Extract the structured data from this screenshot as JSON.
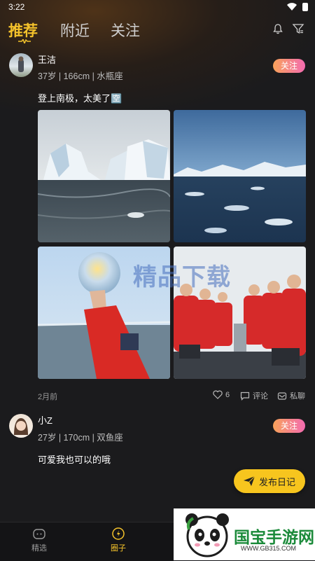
{
  "status": {
    "time": "3:22"
  },
  "tabs": [
    {
      "label": "推荐",
      "active": true
    },
    {
      "label": "附近",
      "active": false
    },
    {
      "label": "关注",
      "active": false
    }
  ],
  "top_icons": [
    "bell-icon",
    "filter-icon"
  ],
  "posts": [
    {
      "username": "王洁",
      "meta": "37岁 | 166cm | 水瓶座",
      "follow_label": "关注",
      "content": "登上南极，太美了🈳",
      "date": "2月前",
      "likes": "6",
      "comment_label": "评论",
      "message_label": "私聊"
    },
    {
      "username": "小Z",
      "meta": "27岁 | 170cm | 双鱼座",
      "follow_label": "关注",
      "content": "可爱我也可以的哦"
    }
  ],
  "publish_label": "发布日记",
  "watermark": {
    "text": "精品下载"
  },
  "bottom_nav": [
    {
      "label": "精选",
      "active": false
    },
    {
      "label": "圈子",
      "active": true
    }
  ],
  "badge": {
    "title": "国宝手游网",
    "url": "WWW.GB315.COM"
  },
  "colors": {
    "accent": "#f4c22b",
    "follow_start": "#f8a25a",
    "follow_end": "#f36bb0",
    "background": "#1b1b1d"
  }
}
